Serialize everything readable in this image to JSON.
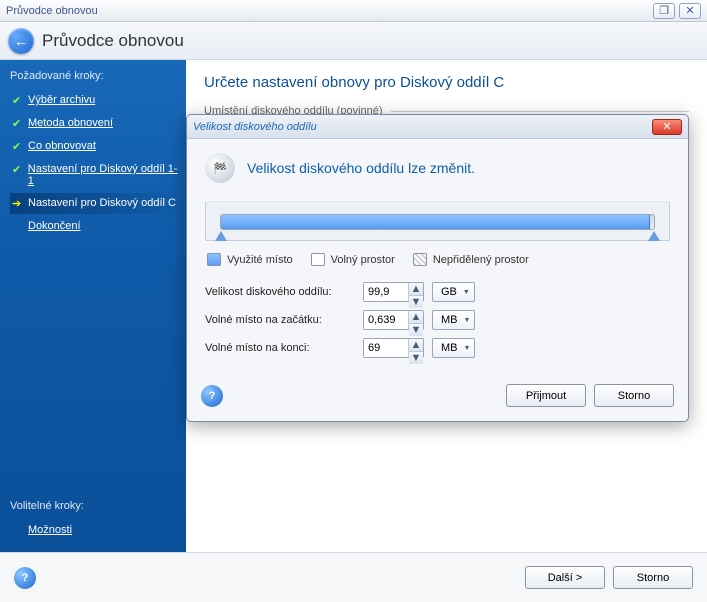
{
  "window": {
    "title": "Průvodce obnovou",
    "restore_glyph": "❐",
    "close_glyph": "✕"
  },
  "header": {
    "title": "Průvodce obnovou",
    "back_glyph": "←"
  },
  "sidebar": {
    "required_label": "Požadované kroky:",
    "optional_label": "Volitelné kroky:",
    "steps": [
      {
        "label": "Výběr archivu",
        "state": "done"
      },
      {
        "label": "Metoda obnovení",
        "state": "done"
      },
      {
        "label": "Co obnovovat",
        "state": "done"
      },
      {
        "label": "Nastavení pro Diskový oddíl 1-1",
        "state": "done"
      },
      {
        "label": "Nastavení pro Diskový oddíl C",
        "state": "current"
      },
      {
        "label": "Dokončení",
        "state": "pending"
      }
    ],
    "optional_steps": [
      {
        "label": "Možnosti"
      }
    ]
  },
  "main": {
    "heading": "Určete nastavení obnovy pro Diskový oddíl C",
    "location_label": "Umístění diskového oddílu (povinné)"
  },
  "dialog": {
    "title": "Velikost diskového oddílu",
    "flag_glyph": "🏁",
    "heading": "Velikost diskového oddílu lze změnit.",
    "legend": {
      "used": "Využité místo",
      "free": "Volný prostor",
      "unalloc": "Nepřidělený prostor"
    },
    "fields": {
      "size_label": "Velikost diskového oddílu:",
      "size_value": "99,9",
      "size_unit": "GB",
      "before_label": "Volné místo na začátku:",
      "before_value": "0,639",
      "before_unit": "MB",
      "after_label": "Volné místo na konci:",
      "after_value": "69",
      "after_unit": "MB"
    },
    "buttons": {
      "accept": "Přijmout",
      "cancel": "Storno"
    },
    "close_glyph": "✕"
  },
  "footer": {
    "next": "Další >",
    "cancel": "Storno"
  },
  "glyphs": {
    "check": "✔",
    "arrow": "➔",
    "up": "▲",
    "down": "▼",
    "caret": "▼",
    "help": "?"
  }
}
